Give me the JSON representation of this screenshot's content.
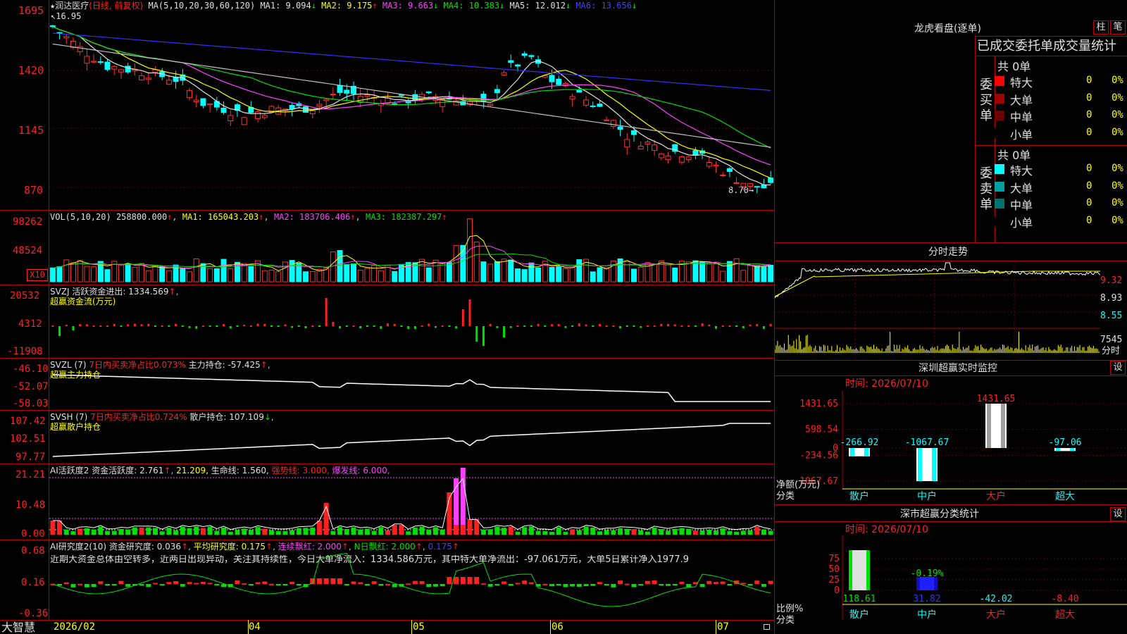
{
  "kline": {
    "star": "★",
    "name": "润达医疗",
    "mode": "(日线, 前复权)",
    "ma_head": "MA(5,10,20,30,60,120)",
    "ma": [
      {
        "label": "MA1:",
        "value": "9.094",
        "arrow": "↓",
        "color": "#e0e0e0"
      },
      {
        "label": "MA2:",
        "value": "9.175",
        "arrow": "↑",
        "color": "#ffff00"
      },
      {
        "label": "MA3:",
        "value": "9.663",
        "arrow": "↓",
        "color": "#ff40ff"
      },
      {
        "label": "MA4:",
        "value": "10.383",
        "arrow": "↓",
        "color": "#00e000"
      },
      {
        "label": "MA5:",
        "value": "12.012",
        "arrow": "↓",
        "color": "#e0e0e0"
      },
      {
        "label": "MA6:",
        "value": "13.656",
        "arrow": "↓",
        "color": "#4040ff"
      }
    ],
    "high_label": "16.95",
    "low_label": "8.70",
    "y_ticks": [
      "1695",
      "1420",
      "1145",
      "870"
    ]
  },
  "vol": {
    "head": "VOL(5,10,20)",
    "value": "258800.000",
    "ma1": "MA1: 165043.203",
    "ma2": "MA2: 183706.406",
    "ma3": "MA3: 182387.297",
    "y_ticks": [
      "98262",
      "48524"
    ],
    "unit": "X10"
  },
  "svzj": {
    "head": "SVZJ",
    "line1": "活跃资金进出: 1334.569",
    "line2": "超赢资金流(万元)",
    "y_ticks": [
      "20532",
      "4312",
      "-11908"
    ]
  },
  "svzl": {
    "head": "SVZL (7)",
    "pct": "7日内买卖净占比0.073%",
    "main": "主力持仓: -57.425",
    "line2": "超赢主力持仓",
    "y_ticks": [
      "-46.10",
      "-52.07",
      "-58.03"
    ]
  },
  "svsh": {
    "head": "SVSH (7)",
    "pct": "7日内买卖净占比0.724%",
    "main": "散户持仓: 107.109",
    "line2": "超赢散户持仓",
    "y_ticks": [
      "107.42",
      "102.51",
      "97.77"
    ]
  },
  "ai1": {
    "head": "AI活跃度2",
    "a": "资金活跃度: 2.761",
    "b": "21.209,",
    "c": "生命线: 1.560,",
    "d": "强势线: 3.000,",
    "e": "爆发线: 6.000,",
    "y_ticks": [
      "21.21",
      "10.48",
      "0.00"
    ]
  },
  "ai2": {
    "head": "AI研究度2(10)",
    "a": "资金研究度: 0.036",
    "b": "平均研究度: 0.175",
    "c": "连续飘红: 2.000",
    "d": "N日飘红: 2.000",
    "e": "0.175",
    "comment": "近期大资金总体由空转多，近两日出现异动，关注其持续性，今日大单净流入：1334.586万元，其中特大单净流出：-97.061万元，大单5日累计净入1977.9",
    "y_ticks": [
      "0.68",
      "0.16",
      "-0.36"
    ]
  },
  "bottom": {
    "brand": "大智慧",
    "dates": [
      "2026/02",
      "04",
      "05",
      "06",
      "07"
    ]
  },
  "lhb": {
    "title": "龙虎看盘(逐单)",
    "btn1": "柱",
    "btn2": "笔",
    "subtitle": "已成交委托单成交量统计",
    "buy_vert": "委买单",
    "sell_vert": "委卖单",
    "buy_total": "共 0单",
    "sell_total": "共 0单",
    "buy_rows": [
      {
        "label": "特大",
        "color": "#ff0000",
        "n": "0",
        "pct": "0%"
      },
      {
        "label": "大单",
        "color": "#a00000",
        "n": "0",
        "pct": "0%"
      },
      {
        "label": "中单",
        "color": "#700000",
        "n": "0",
        "pct": "0%"
      },
      {
        "label": "小单",
        "color": "#000000",
        "n": "0",
        "pct": "0%"
      }
    ],
    "sell_rows": [
      {
        "label": "特大",
        "color": "#00ffff",
        "n": "0",
        "pct": "0%"
      },
      {
        "label": "大单",
        "color": "#00a0a0",
        "n": "0",
        "pct": "0%"
      },
      {
        "label": "中单",
        "color": "#007070",
        "n": "0",
        "pct": "0%"
      },
      {
        "label": "小单",
        "color": "#000000",
        "n": "0",
        "pct": "0%"
      }
    ]
  },
  "intraday": {
    "title": "分时走势",
    "p1": "9.32",
    "p2": "8.93",
    "p3": "8.55",
    "vol": "7545",
    "unit": "分时"
  },
  "realtime": {
    "title": "深圳超赢实时监控",
    "settings": "设",
    "time": "时间: 2026/07/10",
    "y_ticks": [
      "1431.65",
      "598.54",
      "0",
      "-234.56",
      "-1067.67"
    ],
    "ylabel": "净额(万元)",
    "xlabel": "分类",
    "categories": [
      "散户",
      "中户",
      "大户",
      "超大"
    ],
    "values": [
      -266.92,
      -1067.67,
      1431.65,
      -97.06
    ],
    "value_labels": [
      "-266.92",
      "-1067.67",
      "1431.65",
      "-97.06"
    ]
  },
  "classify": {
    "title": "深市超赢分类统计",
    "settings": "设",
    "time": "时间: 2026/07/10",
    "y_ticks": [
      "75",
      "50",
      "25",
      "0"
    ],
    "ylabel": "比例%",
    "xlabel": "分类",
    "categories": [
      "散户",
      "中户",
      "大户",
      "超大"
    ],
    "bar_pcts": [
      75,
      25,
      0,
      0
    ],
    "bar_label": "-0.19%",
    "value_labels": [
      "118.61",
      "31.82",
      "-42.02",
      "-8.40"
    ]
  },
  "chart_data": {
    "type": "bar",
    "title": "深圳超赢实时监控",
    "categories": [
      "散户",
      "中户",
      "大户",
      "超大"
    ],
    "values": [
      -266.92,
      -1067.67,
      1431.65,
      -97.06
    ],
    "ylabel": "净额(万元)",
    "ylim": [
      -1067.67,
      1431.65
    ]
  }
}
